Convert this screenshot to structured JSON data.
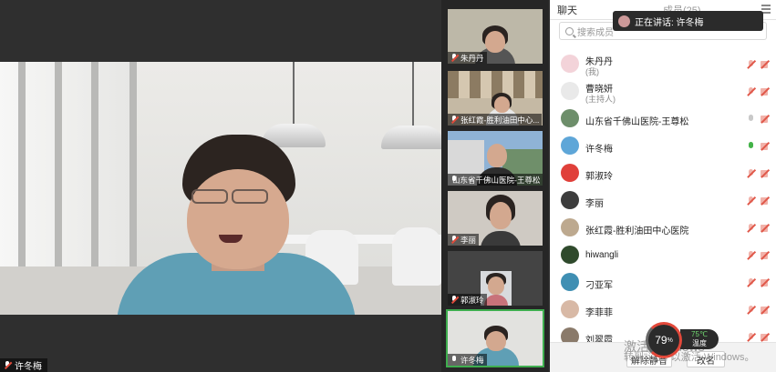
{
  "main": {
    "speaker_label": "许冬梅"
  },
  "thumbnails": [
    {
      "label": "朱丹丹",
      "mic": "muted"
    },
    {
      "label": "张红霞-胜利油田中心...",
      "mic": "muted"
    },
    {
      "label": "山东省千佛山医院-王尊松",
      "mic": "on"
    },
    {
      "label": "李丽",
      "mic": "muted"
    },
    {
      "label": "郭淑玲",
      "mic": "muted"
    },
    {
      "label": "许冬梅",
      "mic": "on"
    }
  ],
  "panel": {
    "tab_chat": "聊天",
    "tab_members": "成员(25)",
    "search_placeholder": "搜索成员",
    "toast": "正在讲话: 许冬梅",
    "participants": [
      {
        "name": "朱丹丹",
        "role": "(我)",
        "mic": "off",
        "avatar_color": "#f3d3d9"
      },
      {
        "name": "曹晓妍",
        "role": "(主持人)",
        "mic": "off",
        "avatar_color": "#e9e9e9"
      },
      {
        "name": "山东省千佛山医院-王尊松",
        "role": "",
        "mic": "idle",
        "avatar_color": "#6d8e6a"
      },
      {
        "name": "许冬梅",
        "role": "",
        "mic": "on",
        "avatar_color": "#5ea6d8"
      },
      {
        "name": "郭淑玲",
        "role": "",
        "mic": "off",
        "avatar_color": "#e0403a"
      },
      {
        "name": "李丽",
        "role": "",
        "mic": "off",
        "avatar_color": "#3d3d3d"
      },
      {
        "name": "张红霞-胜利油田中心医院",
        "role": "",
        "mic": "off",
        "avatar_color": "#bda98f"
      },
      {
        "name": "hiwangli",
        "role": "",
        "mic": "off",
        "avatar_color": "#2f4a2c"
      },
      {
        "name": "刁亚军",
        "role": "",
        "mic": "off",
        "avatar_color": "#3f8fb3"
      },
      {
        "name": "李菲菲",
        "role": "",
        "mic": "off",
        "avatar_color": "#d8b9a6"
      },
      {
        "name": "刘翠霞",
        "role": "",
        "mic": "off",
        "avatar_color": "#8a7a6a"
      }
    ],
    "footer": {
      "mute_all": "解除静音",
      "rename": "改名"
    }
  },
  "overlay": {
    "activate_line1": "激活 Windows",
    "activate_line2": "转到\"设置\"以激活 Windows。",
    "cpu_value": "79",
    "cpu_unit": "%",
    "temp_value": "75℃",
    "temp_label": "温度"
  }
}
